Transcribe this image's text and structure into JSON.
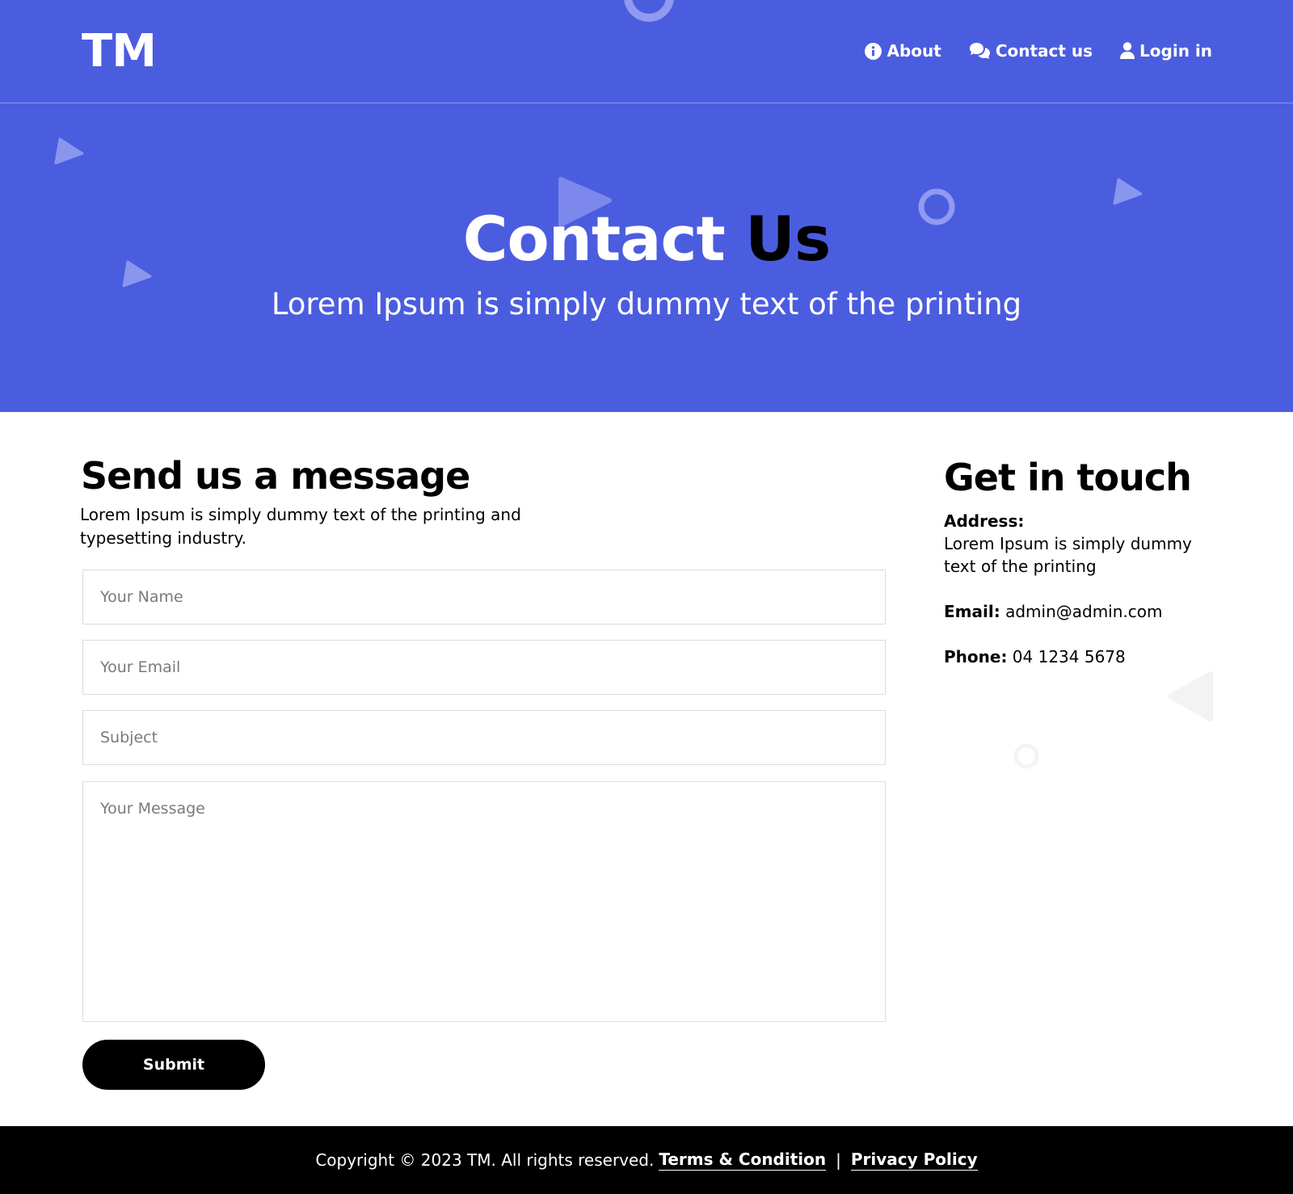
{
  "brand": {
    "logo": "TM",
    "accent": "#4b5ddf"
  },
  "nav": {
    "items": [
      {
        "label": "About",
        "icon": "info-icon"
      },
      {
        "label": "Contact us",
        "icon": "chat-icon"
      },
      {
        "label": "Login in",
        "icon": "user-icon"
      }
    ]
  },
  "hero": {
    "title_white": "Contact",
    "title_black": "Us",
    "subtitle": "Lorem Ipsum is simply dummy text of the printing"
  },
  "message": {
    "title": "Send us a message",
    "description": "Lorem Ipsum is simply dummy text of the printing and typesetting industry.",
    "fields": {
      "name_placeholder": "Your Name",
      "email_placeholder": "Your Email",
      "subject_placeholder": "Subject",
      "message_placeholder": "Your Message"
    },
    "submit_label": "Submit"
  },
  "contact": {
    "title": "Get in touch",
    "address_label": "Address:",
    "address_value": "Lorem Ipsum is simply dummy text of the printing",
    "email_label": "Email:",
    "email_value": "admin@admin.com",
    "phone_label": "Phone:",
    "phone_value": "04 1234 5678"
  },
  "footer": {
    "copyright": "Copyright ©  2023 TM. All rights reserved.",
    "terms": "Terms & Condition",
    "separator": "|",
    "privacy": "Privacy Policy"
  }
}
